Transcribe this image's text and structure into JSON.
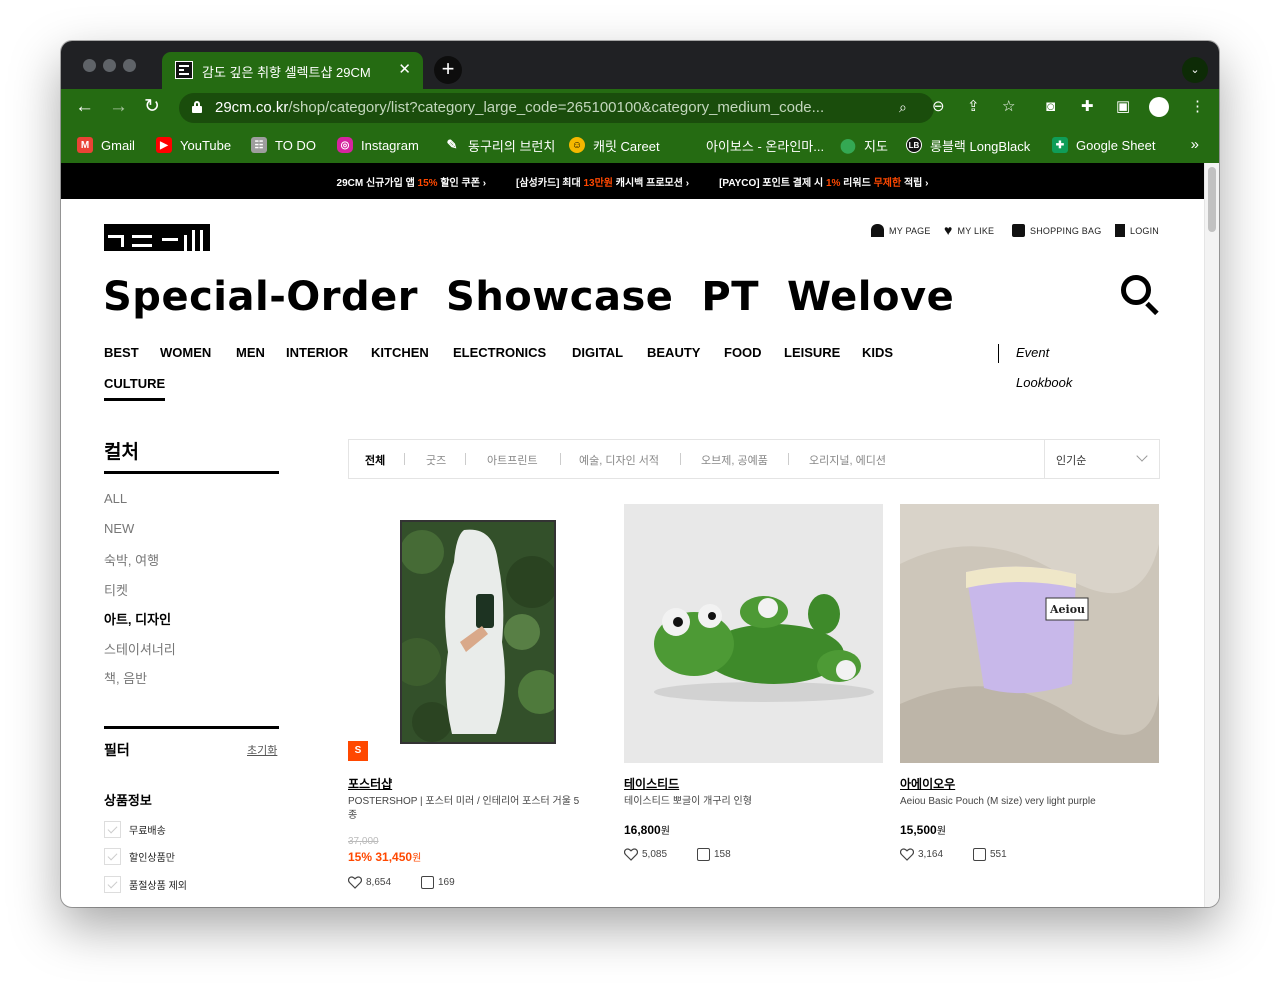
{
  "browser": {
    "tab_title": "감도 깊은 취향 셀렉트샵 29CM",
    "url_host": "29cm.co.kr",
    "url_path": "/shop/category/list?category_large_code=265100100&category_medium_code...",
    "bookmarks": [
      {
        "label": "Gmail",
        "icon": "gmail-icon",
        "color": "#ea4335"
      },
      {
        "label": "YouTube",
        "icon": "youtube-icon",
        "color": "#ff0000"
      },
      {
        "label": "TO DO",
        "icon": "todo-icon",
        "color": "#9e9e9e"
      },
      {
        "label": "Instagram",
        "icon": "instagram-icon",
        "color": "#d6249f"
      },
      {
        "label": "동구리의 브런치",
        "icon": "brunch-icon",
        "color": "#256b12"
      },
      {
        "label": "캐릿 Careet",
        "icon": "careet-icon",
        "color": "#f5b800"
      },
      {
        "label": "아이보스 - 온라인마...",
        "icon": "iboss-icon",
        "color": "#e53935"
      },
      {
        "label": "지도",
        "icon": "maps-icon",
        "color": "#34a853"
      },
      {
        "label": "롱블랙 LongBlack",
        "icon": "longblack-icon",
        "color": "#111111"
      },
      {
        "label": "Google Sheet",
        "icon": "sheets-icon",
        "color": "#0f9d58"
      }
    ],
    "bookmarks_more": "»"
  },
  "promo": {
    "items": [
      {
        "pre": "29CM 신규가입 앱 ",
        "hl": "15%",
        "post": " 할인 쿠폰 ›"
      },
      {
        "pre": "[삼성카드] 최대 ",
        "hl": "13만원",
        "post": " 캐시백 프로모션 ›"
      },
      {
        "pre": "[PAYCO] 포인트 결제 시 ",
        "hl": "1%",
        "post": " 리워드 ",
        "hl2": "무제한",
        "post2": " 적립 ›"
      }
    ],
    "highlight_color": "#ff4800"
  },
  "header": {
    "util_links": [
      "MY PAGE",
      "MY LIKE",
      "SHOPPING BAG",
      "LOGIN"
    ],
    "headline": [
      "Special-Order",
      "Showcase",
      "PT",
      "Welove"
    ],
    "categories": [
      "BEST",
      "WOMEN",
      "MEN",
      "INTERIOR",
      "KITCHEN",
      "ELECTRONICS",
      "DIGITAL",
      "BEAUTY",
      "FOOD",
      "LEISURE",
      "KIDS",
      "CULTURE"
    ],
    "active_category": "CULTURE",
    "side_links": [
      "Event",
      "Lookbook"
    ]
  },
  "sidebar": {
    "title": "컬처",
    "items": [
      "ALL",
      "NEW",
      "숙박, 여행",
      "티켓",
      "아트, 디자인",
      "스테이셔너리",
      "책, 음반"
    ],
    "selected": "아트, 디자인",
    "filter_title": "필터",
    "filter_reset": "초기화",
    "filter_section": "상품정보",
    "filters": [
      "무료배송",
      "할인상품만",
      "품절상품 제외"
    ]
  },
  "subcategories": {
    "tabs": [
      "전체",
      "굿즈",
      "아트프린트",
      "예술, 디자인 서적",
      "오브제, 공예품",
      "오리지널, 에디션"
    ],
    "selected": "전체",
    "sort_label": "인기순"
  },
  "products": [
    {
      "brand": "포스터샵",
      "name": "POSTERSHOP | 포스터 미러 / 인테리어 포스터 거울 5종",
      "badge": "S",
      "original_price": "37,000",
      "discount": "15%",
      "price": "31,450",
      "currency": "원",
      "likes": "8,654",
      "reviews": "169"
    },
    {
      "brand": "테이스티드",
      "name": "테이스티드 뽀글이 개구리 인형",
      "price": "16,800",
      "currency": "원",
      "likes": "5,085",
      "reviews": "158"
    },
    {
      "brand": "아에이오우",
      "name": "Aeiou Basic Pouch (M size) very light purple",
      "price": "15,500",
      "currency": "원",
      "likes": "3,164",
      "reviews": "551"
    }
  ]
}
